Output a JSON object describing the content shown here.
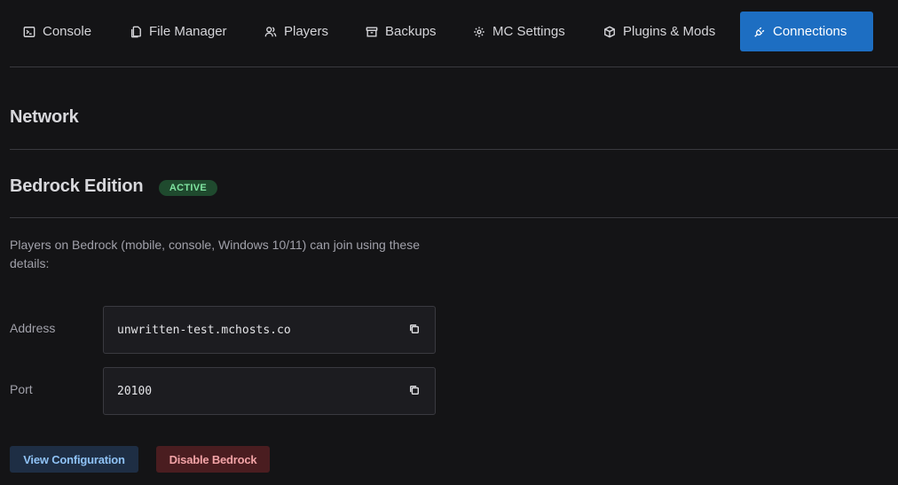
{
  "tabs": [
    {
      "label": "Console",
      "icon": "terminal-icon"
    },
    {
      "label": "File Manager",
      "icon": "files-icon"
    },
    {
      "label": "Players",
      "icon": "users-icon"
    },
    {
      "label": "Backups",
      "icon": "archive-icon"
    },
    {
      "label": "MC Settings",
      "icon": "gear-icon"
    },
    {
      "label": "Plugins & Mods",
      "icon": "package-icon"
    },
    {
      "label": "Connections",
      "icon": "plug-icon",
      "active": true
    }
  ],
  "network": {
    "title": "Network"
  },
  "bedrock": {
    "title": "Bedrock Edition",
    "status_badge": "ACTIVE",
    "description": "Players on Bedrock (mobile, console, Windows 10/11) can join using these details:",
    "address_label": "Address",
    "address_value": "unwritten-test.mchosts.co",
    "port_label": "Port",
    "port_value": "20100",
    "view_config_label": "View Configuration",
    "disable_label": "Disable Bedrock"
  },
  "colors": {
    "accent": "#1d6ec2",
    "active_badge_bg": "#1f4a2e",
    "active_badge_text": "#7fe3a0",
    "danger_bg": "#4a1d20",
    "danger_text": "#f2a3a6"
  }
}
